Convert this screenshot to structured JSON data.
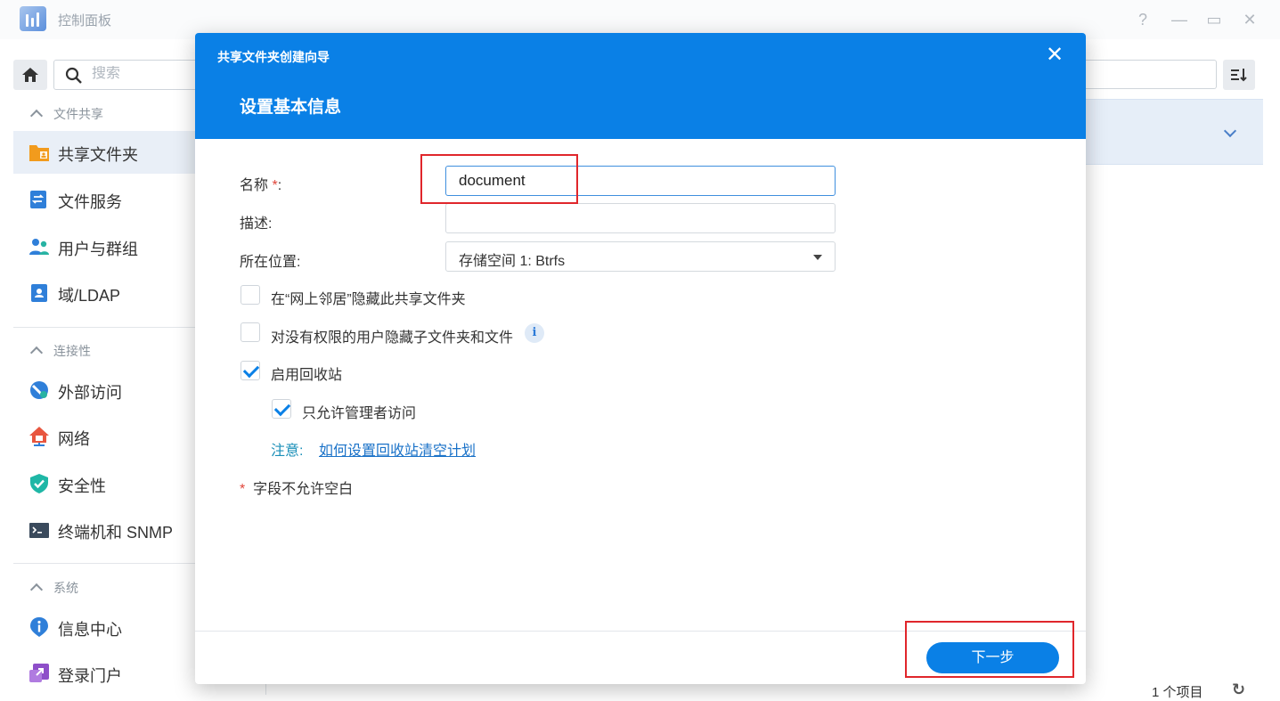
{
  "window": {
    "title": "控制面板",
    "controls": [
      "?",
      "—",
      "▭",
      "✕"
    ]
  },
  "sidebar": {
    "search_placeholder": "搜索",
    "sections": [
      {
        "label": "文件共享",
        "items": [
          {
            "label": "共享文件夹",
            "icon": "shared-folder-icon",
            "active": true
          },
          {
            "label": "文件服务",
            "icon": "file-services-icon"
          },
          {
            "label": "用户与群组",
            "icon": "users-groups-icon"
          },
          {
            "label": "域/LDAP",
            "icon": "domain-ldap-icon"
          }
        ]
      },
      {
        "label": "连接性",
        "items": [
          {
            "label": "外部访问",
            "icon": "external-access-icon"
          },
          {
            "label": "网络",
            "icon": "network-icon"
          },
          {
            "label": "安全性",
            "icon": "security-shield-icon"
          },
          {
            "label": "终端机和 SNMP",
            "icon": "terminal-icon"
          }
        ]
      },
      {
        "label": "系统",
        "items": [
          {
            "label": "信息中心",
            "icon": "info-center-icon"
          },
          {
            "label": "登录门户",
            "icon": "login-portal-icon"
          }
        ]
      }
    ]
  },
  "main": {
    "item_count": "1 个项目"
  },
  "dialog": {
    "wizard_title": "共享文件夹创建向导",
    "step_title": "设置基本信息",
    "fields": {
      "name_label": "名称",
      "name_required": "*",
      "name_colon": ":",
      "name_value": "document",
      "description_label": "描述:",
      "description_value": "",
      "location_label": "所在位置:",
      "location_value": "存储空间 1:  Btrfs"
    },
    "options": {
      "hide_network": {
        "label": "在“网上邻居”隐藏此共享文件夹",
        "checked": false
      },
      "hide_subfolders": {
        "label": "对没有权限的用户隐藏子文件夹和文件",
        "checked": false
      },
      "enable_recycle": {
        "label": "启用回收站",
        "checked": true
      },
      "admin_only": {
        "label": "只允许管理者访问",
        "checked": true
      }
    },
    "note_label": "注意:",
    "note_link": "如何设置回收站清空计划",
    "required_note_star": "*",
    "required_note": "字段不允许空白",
    "next_button": "下一步"
  },
  "colors": {
    "header_blue": "#0a80e6",
    "annotation_red": "#e0262b",
    "active_nav_bg": "#e9eff7"
  }
}
